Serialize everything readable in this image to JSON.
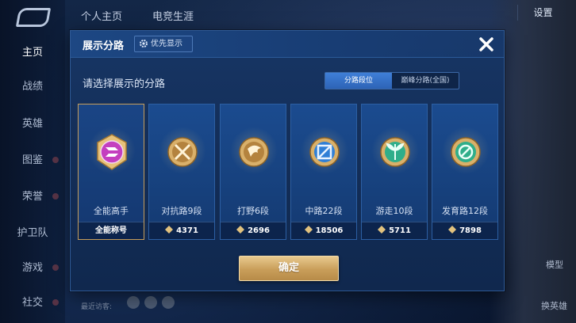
{
  "background": {
    "top_tabs": [
      "个人主页",
      "电竞生涯"
    ],
    "settings_label": "设置",
    "sidebar": [
      {
        "label": "主页",
        "active": true
      },
      {
        "label": "战绩"
      },
      {
        "label": "英雄"
      },
      {
        "label": "图鉴"
      },
      {
        "label": "荣誉"
      },
      {
        "label": "护卫队"
      },
      {
        "label": "游戏"
      },
      {
        "label": "社交"
      }
    ],
    "right_captions": {
      "model": "模型",
      "swap_hero": "换英雄"
    },
    "recent_visitors_label": "最近访客:"
  },
  "dialog": {
    "title": "展示分路",
    "priority_label": "优先显示",
    "subtitle": "请选择展示的分路",
    "segments": {
      "active": "分路段位",
      "inactive": "巅峰分路(全国)"
    },
    "cards": [
      {
        "icon": "all-rounder-badge-icon",
        "label": "全能高手",
        "footer": "全能称号",
        "selected": true,
        "color": "#c43fbf"
      },
      {
        "icon": "clash-lane-badge-icon",
        "label": "对抗路9段",
        "footer": "4371",
        "color": "#c89a4a"
      },
      {
        "icon": "jungle-badge-icon",
        "label": "打野6段",
        "footer": "2696",
        "color": "#c89a4a"
      },
      {
        "icon": "mid-lane-badge-icon",
        "label": "中路22段",
        "footer": "18506",
        "color": "#2f7fd6"
      },
      {
        "icon": "roam-badge-icon",
        "label": "游走10段",
        "footer": "5711",
        "color": "#2fae8a"
      },
      {
        "icon": "farm-lane-badge-icon",
        "label": "发育路12段",
        "footer": "7898",
        "color": "#2fae8a"
      }
    ],
    "confirm_label": "确定"
  },
  "colors": {
    "gold": "#c99e5a",
    "panel": "#173665",
    "accent_blue": "#3f7fd8"
  }
}
